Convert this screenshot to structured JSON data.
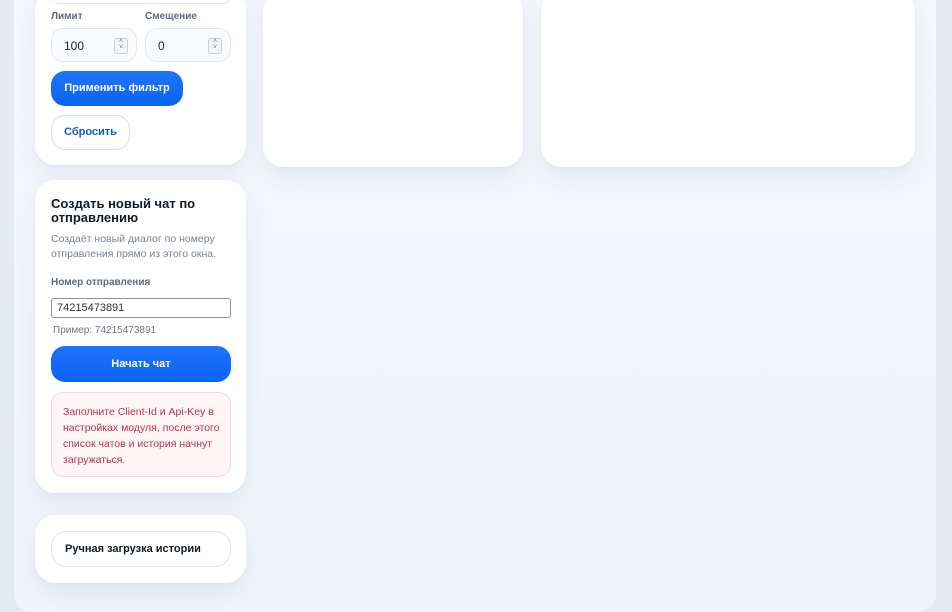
{
  "filter": {
    "limit_label": "Лимит",
    "limit_value": "100",
    "offset_label": "Смещение",
    "offset_value": "0",
    "apply_label": "Применить фильтр",
    "reset_label": "Сбросить"
  },
  "create_chat": {
    "title": "Создать новый чат по отправлению",
    "description": "Создаёт новый диалог по номеру отправления прямо из этого окна.",
    "shipment_label": "Номер отправления",
    "shipment_value": "74215473891",
    "shipment_hint": "Пример: 74215473891",
    "start_label": "Начать чат",
    "alert_text": "Заполните Client-Id и Api-Key в настройках модуля, после этого список чатов и история начнут загружаться."
  },
  "manual": {
    "load_history_label": "Ручная загрузка истории"
  },
  "colors": {
    "accent": "#0d6efd",
    "alert_text": "#b0335a",
    "alert_bg": "#fff5f7"
  }
}
